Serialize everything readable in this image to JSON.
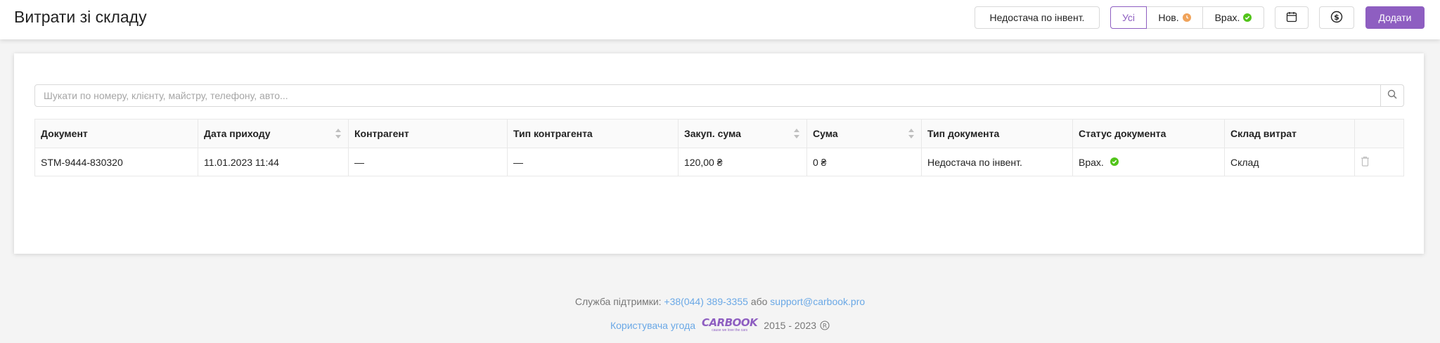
{
  "header": {
    "title": "Витрати зі складу",
    "filters": {
      "inventory_shortage": "Недостача по інвент.",
      "all": "Усі",
      "new": "Нов.",
      "accounted": "Врах."
    },
    "add_label": "Додати"
  },
  "search": {
    "placeholder": "Шукати по номеру, клієнту, майстру, телефону, авто..."
  },
  "table": {
    "columns": [
      "Документ",
      "Дата приходу",
      "Контрагент",
      "Тип контрагента",
      "Закуп. сума",
      "Сума",
      "Тип документа",
      "Статус документа",
      "Склад витрат"
    ],
    "rows": [
      {
        "document": "STM-9444-830320",
        "date": "11.01.2023 11:44",
        "counterparty": "—",
        "counterparty_type": "—",
        "purchase_sum": "120,00 ₴",
        "sum": "0 ₴",
        "doc_type": "Недостача по інвент.",
        "status": "Врах.",
        "warehouse": "Склад"
      }
    ]
  },
  "footer": {
    "support_label": "Служба підтримки:",
    "phone": "+38(044) 389-3355",
    "or": "або",
    "email": "support@carbook.pro",
    "agreement": "Користувача угода",
    "logo_text": "CARBOOK",
    "logo_tagline": "cause we love the cars",
    "years": "2015 - 2023"
  },
  "colors": {
    "accent": "#8e5ec1",
    "link": "#6aa8e6",
    "status_new": "#f0a35a",
    "status_accounted": "#52c41a"
  },
  "icons": [
    "calendar-icon",
    "dollar-icon",
    "search-icon",
    "clock-icon",
    "check-icon",
    "trash-icon",
    "registered-icon"
  ]
}
